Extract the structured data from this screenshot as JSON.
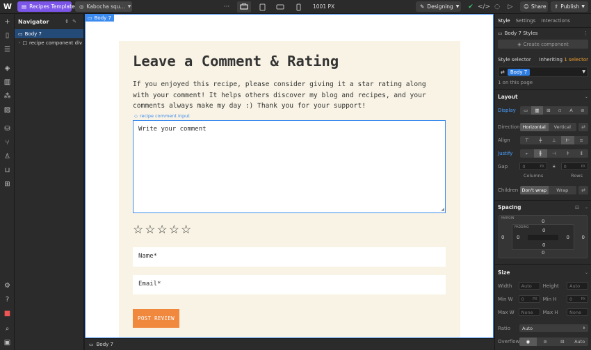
{
  "topbar": {
    "logo": "W",
    "page_name": "Recipes Template",
    "site_name": "Kabocha squ...",
    "more": "···",
    "width_readout": "1001 PX",
    "mode": "Designing",
    "share": "Share",
    "publish": "Publish"
  },
  "navigator": {
    "title": "Navigator",
    "items": [
      {
        "label": "Body 7"
      },
      {
        "label": "recipe component div"
      }
    ]
  },
  "canvas": {
    "selected_tag": "Body 7",
    "heading": "Leave a Comment & Rating",
    "intro": "If you enjoyed this recipe, please consider giving it a star rating along with your comment! It helps others discover my blog and recipes, and your comments always make my day :) Thank you for your support!",
    "component_label": "recipe comment input",
    "comment_placeholder": "Write your comment",
    "rating": {
      "max": 5,
      "value": 0
    },
    "name_placeholder": "Name*",
    "email_placeholder": "Email*",
    "post_button": "POST REVIEW"
  },
  "breadcrumb": {
    "item": "Body 7"
  },
  "panel": {
    "tabs": [
      "Style",
      "Settings",
      "Interactions"
    ],
    "styles_title": "Body 7 Styles",
    "create_component": "Create component",
    "style_selector_label": "Style selector",
    "inheriting_prefix": "Inheriting",
    "inheriting_count": "1",
    "inheriting_suffix": "selector",
    "selector_chip": "Body 7",
    "on_page": "1 on this page",
    "layout": {
      "title": "Layout",
      "display_label": "Display",
      "direction_label": "Direction",
      "direction_options": [
        "Horizontal",
        "Vertical"
      ],
      "direction_selected": "Horizontal",
      "align_label": "Align",
      "justify_label": "Justify",
      "gap_label": "Gap",
      "gap_columns": "0",
      "gap_rows": "0",
      "gap_unit": "PX",
      "columns_label": "Columns",
      "rows_label": "Rows",
      "children_label": "Children",
      "children_options": [
        "Don't wrap",
        "Wrap"
      ],
      "children_selected": "Don't wrap"
    },
    "spacing": {
      "title": "Spacing",
      "margin_label": "MARGIN",
      "padding_label": "PADDING",
      "margin": {
        "top": "0",
        "right": "0",
        "bottom": "0",
        "left": "0"
      },
      "padding": {
        "top": "0",
        "right": "0",
        "bottom": "0",
        "left": "0"
      }
    },
    "size": {
      "title": "Size",
      "width_label": "Width",
      "width_value": "Auto",
      "height_label": "Height",
      "height_value": "Auto",
      "min_w_label": "Min W",
      "min_w_value": "0",
      "min_h_label": "Min H",
      "min_h_value": "0",
      "max_w_label": "Max W",
      "max_w_value": "None",
      "max_h_label": "Max H",
      "max_h_value": "None",
      "unit": "PX",
      "ratio_label": "Ratio",
      "ratio_value": "Auto",
      "overflow_label": "Overflow",
      "overflow_auto": "Auto"
    }
  },
  "colors": {
    "accent_blue": "#3a8af0",
    "brand_purple": "#7c56e8",
    "card_bg": "#f8f3e4",
    "button_orange": "#f0883e",
    "chip_blue": "#2f7de1"
  }
}
